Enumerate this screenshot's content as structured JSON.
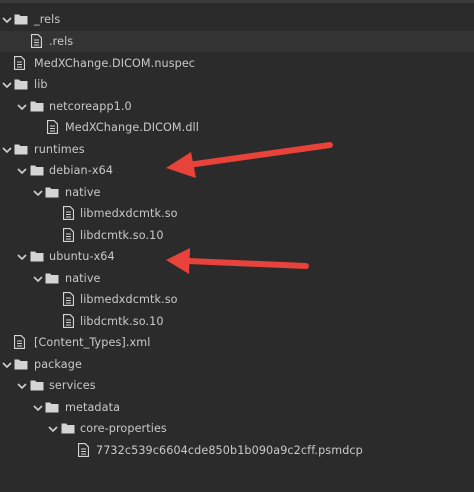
{
  "tree": {
    "items": [
      {
        "label": "_rels",
        "type": "folder",
        "expanded": true
      },
      {
        "label": ".rels",
        "type": "file",
        "selected": true
      },
      {
        "label": "MedXChange.DICOM.nuspec",
        "type": "file"
      },
      {
        "label": "lib",
        "type": "folder",
        "expanded": true
      },
      {
        "label": "netcoreapp1.0",
        "type": "folder",
        "expanded": true
      },
      {
        "label": "MedXChange.DICOM.dll",
        "type": "file"
      },
      {
        "label": "runtimes",
        "type": "folder",
        "expanded": true
      },
      {
        "label": "debian-x64",
        "type": "folder",
        "expanded": true
      },
      {
        "label": "native",
        "type": "folder",
        "expanded": true
      },
      {
        "label": "libmedxdcmtk.so",
        "type": "file"
      },
      {
        "label": "libdcmtk.so.10",
        "type": "file"
      },
      {
        "label": "ubuntu-x64",
        "type": "folder",
        "expanded": true
      },
      {
        "label": "native",
        "type": "folder",
        "expanded": true
      },
      {
        "label": "libmedxdcmtk.so",
        "type": "file"
      },
      {
        "label": "libdcmtk.so.10",
        "type": "file"
      },
      {
        "label": "[Content_Types].xml",
        "type": "file"
      },
      {
        "label": "package",
        "type": "folder",
        "expanded": true
      },
      {
        "label": "services",
        "type": "folder",
        "expanded": true
      },
      {
        "label": "metadata",
        "type": "folder",
        "expanded": true
      },
      {
        "label": "core-properties",
        "type": "folder",
        "expanded": true
      },
      {
        "label": "7732c539c6604cde850b1b090a9c2cff.psmdcp",
        "type": "file"
      }
    ]
  },
  "annotations": {
    "arrow_color": "#e8433b",
    "arrow_targets": [
      "debian-x64",
      "ubuntu-x64"
    ]
  },
  "colors": {
    "background": "#2b2b2b",
    "selected_row": "#343434",
    "text": "#c9c9c9",
    "icon": "#d4d4d4"
  }
}
